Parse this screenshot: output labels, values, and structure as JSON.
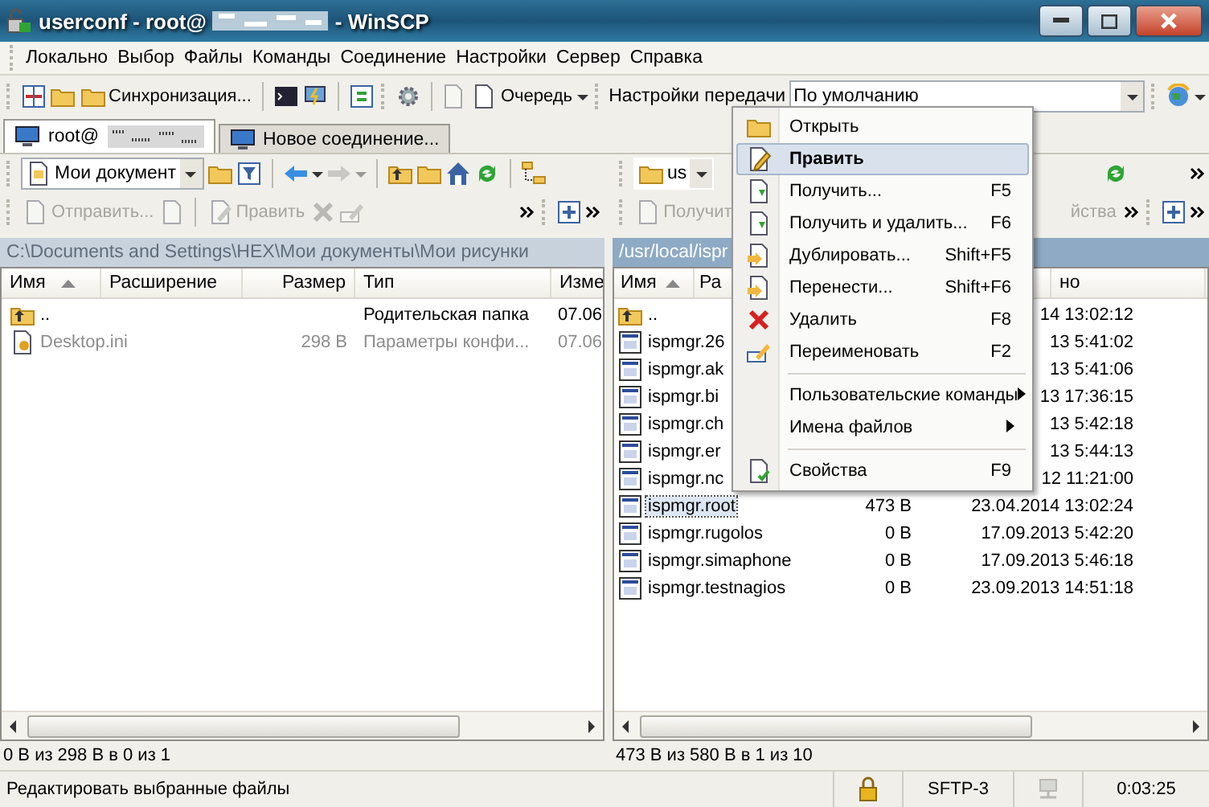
{
  "window": {
    "title_start": "userconf - root@",
    "title_end": "- WinSCP"
  },
  "menu_bar": [
    "Локально",
    "Выбор",
    "Файлы",
    "Команды",
    "Соединение",
    "Настройки",
    "Сервер",
    "Справка"
  ],
  "toolbar": {
    "sync_label": "Синхронизация...",
    "queue_label": "Очередь",
    "transfer_label": "Настройки передачи",
    "transfer_preset": "По умолчанию"
  },
  "session_tabs": [
    {
      "label": "root@",
      "selected": true
    },
    {
      "label": "Новое соединение...",
      "selected": false
    }
  ],
  "left_panel": {
    "location": "Мои документ",
    "actions": [
      {
        "label": "Отправить...",
        "disabled": true
      },
      {
        "label": "Править",
        "disabled": true
      }
    ],
    "path": "C:\\Documents and Settings\\HEX\\Мои документы\\Мои рисунки",
    "path_active": false,
    "columns": [
      "Имя",
      "Расширение",
      "Размер",
      "Тип",
      "Изме"
    ],
    "rows": [
      {
        "name": "..",
        "kind": "parent",
        "type": "Родительская папка",
        "changed": "07.06",
        "hidden": false
      },
      {
        "name": "Desktop.ini",
        "kind": "file",
        "size": "298 B",
        "type": "Параметры конфи...",
        "changed": "07.06",
        "hidden": true
      }
    ],
    "status": "0 В из 298 В в 0 из 1"
  },
  "right_panel": {
    "location": "us",
    "actions": [
      {
        "label": "Получит",
        "disabled": true
      },
      {
        "label": "йства",
        "disabled": true
      }
    ],
    "path": "/usr/local/ispr",
    "path_active": true,
    "columns": [
      "Имя",
      "Ра",
      "но"
    ],
    "rows": [
      {
        "name": "..",
        "kind": "parent",
        "changed": "14 13:02:12",
        "selected": false
      },
      {
        "name": "ispmgr.26",
        "kind": "file",
        "changed": "13 5:41:02",
        "selected": false
      },
      {
        "name": "ispmgr.ak",
        "kind": "file",
        "changed": "13 5:41:06",
        "selected": false
      },
      {
        "name": "ispmgr.bi",
        "kind": "file",
        "changed": "13 17:36:15",
        "selected": false
      },
      {
        "name": "ispmgr.ch",
        "kind": "file",
        "changed": "13 5:42:18",
        "selected": false
      },
      {
        "name": "ispmgr.er",
        "kind": "file",
        "changed": "13 5:44:13",
        "selected": false
      },
      {
        "name": "ispmgr.nc",
        "kind": "file",
        "changed": "12 11:21:00",
        "selected": false
      },
      {
        "name": "ispmgr.root",
        "kind": "file",
        "size": "473 B",
        "changed": "23.04.2014 13:02:24",
        "selected": true
      },
      {
        "name": "ispmgr.rugolos",
        "kind": "file",
        "size": "0 B",
        "changed": "17.09.2013 5:42:20",
        "selected": false
      },
      {
        "name": "ispmgr.simaphone",
        "kind": "file",
        "size": "0 B",
        "changed": "17.09.2013 5:46:18",
        "selected": false
      },
      {
        "name": "ispmgr.testnagios",
        "kind": "file",
        "size": "0 B",
        "changed": "23.09.2013 14:51:18",
        "selected": false
      }
    ],
    "status": "473 В из 580 В в 1 из 10"
  },
  "context_menu": {
    "items": [
      {
        "kind": "item",
        "label": "Открыть",
        "selected": false
      },
      {
        "kind": "item",
        "label": "Править",
        "selected": true
      },
      {
        "kind": "item",
        "label": "Получить...",
        "shortcut": "F5",
        "selected": false
      },
      {
        "kind": "item",
        "label": "Получить и удалить...",
        "shortcut": "F6",
        "selected": false
      },
      {
        "kind": "item",
        "label": "Дублировать...",
        "shortcut": "Shift+F5",
        "selected": false
      },
      {
        "kind": "item",
        "label": "Перенести...",
        "shortcut": "Shift+F6",
        "selected": false
      },
      {
        "kind": "item",
        "label": "Удалить",
        "shortcut": "F8",
        "selected": false
      },
      {
        "kind": "item",
        "label": "Переименовать",
        "shortcut": "F2",
        "selected": false
      },
      {
        "kind": "separator"
      },
      {
        "kind": "submenu",
        "label": "Пользовательские команды",
        "selected": false
      },
      {
        "kind": "submenu",
        "label": "Имена файлов",
        "selected": false
      },
      {
        "kind": "separator"
      },
      {
        "kind": "item",
        "label": "Свойства",
        "shortcut": "F9",
        "selected": false
      }
    ]
  },
  "status_bar": {
    "message": "Редактировать выбранные файлы",
    "protocol": "SFTP-3",
    "elapsed": "0:03:25"
  }
}
